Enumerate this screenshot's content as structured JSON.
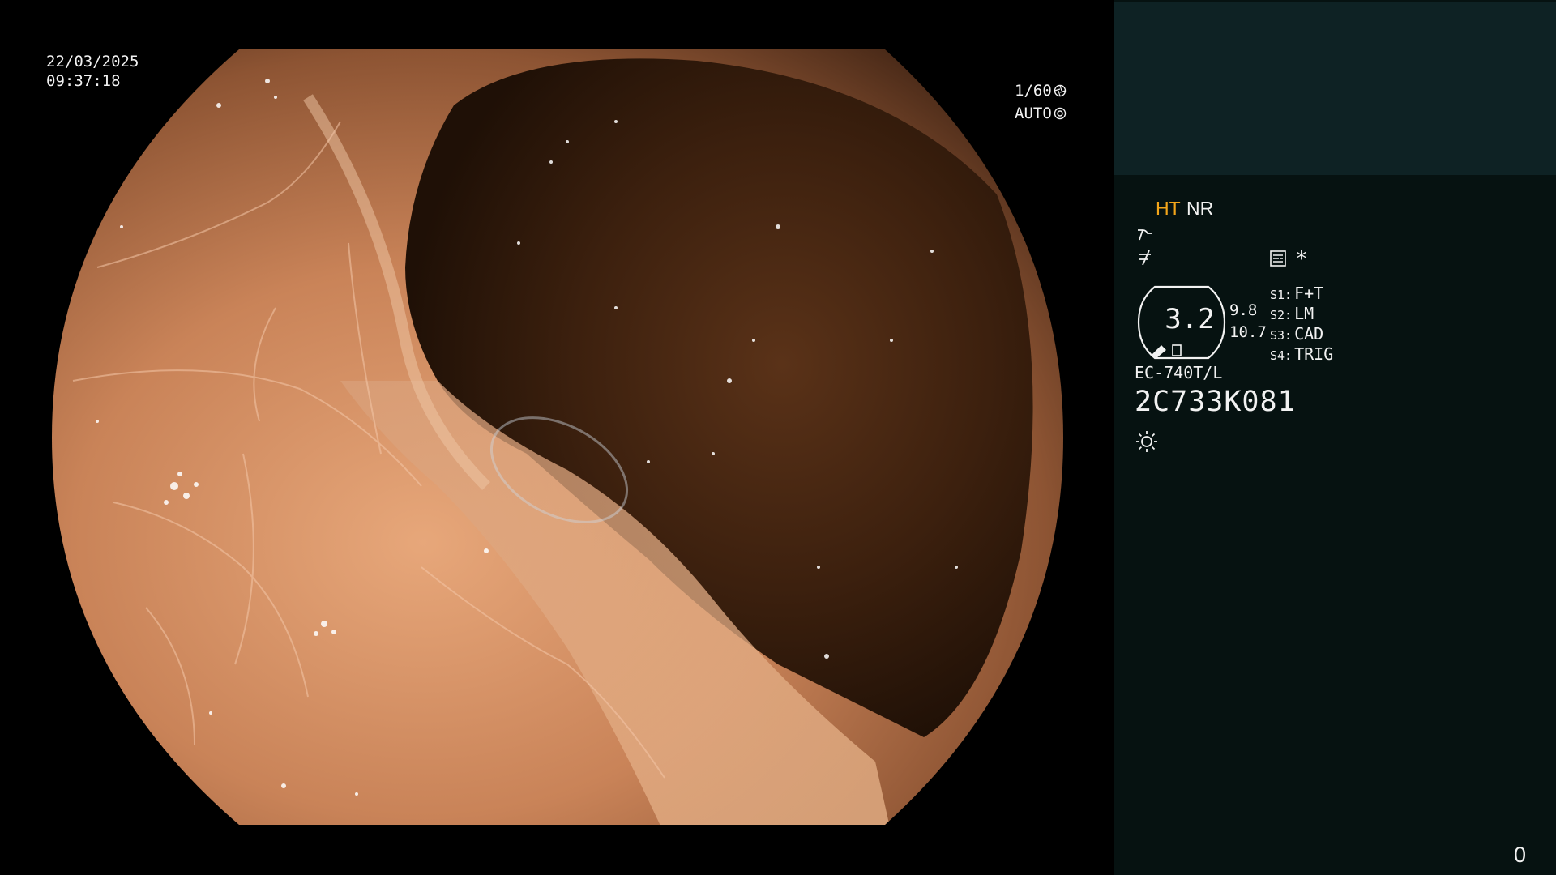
{
  "overlay": {
    "date": "22/03/2025",
    "time": "09:37:18",
    "shutter": "1/60",
    "exposure_mode": "AUTO"
  },
  "panel": {
    "ht_label": "HT",
    "nr_label": "NR",
    "zoom": {
      "value": "3.2",
      "upper": "9.8",
      "lower": "10.7"
    },
    "star": "*",
    "switches": [
      {
        "key": "S1:",
        "label": "F+T"
      },
      {
        "key": "S2:",
        "label": "LM"
      },
      {
        "key": "S3:",
        "label": "CAD"
      },
      {
        "key": "S4:",
        "label": "TRIG"
      }
    ],
    "scope_model": "EC-740T/L",
    "scope_serial": "2C733K081",
    "image_counter": "0",
    "colors": {
      "ht": "#f3a51a",
      "text": "#f2f2f2",
      "panel_bg": "#061211",
      "thumb_bg": "#0e2224"
    },
    "icons": [
      "brightness-curve-icon",
      "enhancement-icon",
      "memory-card-icon",
      "light-sun-icon",
      "shutter-aperture-icon",
      "auto-iris-icon"
    ]
  }
}
